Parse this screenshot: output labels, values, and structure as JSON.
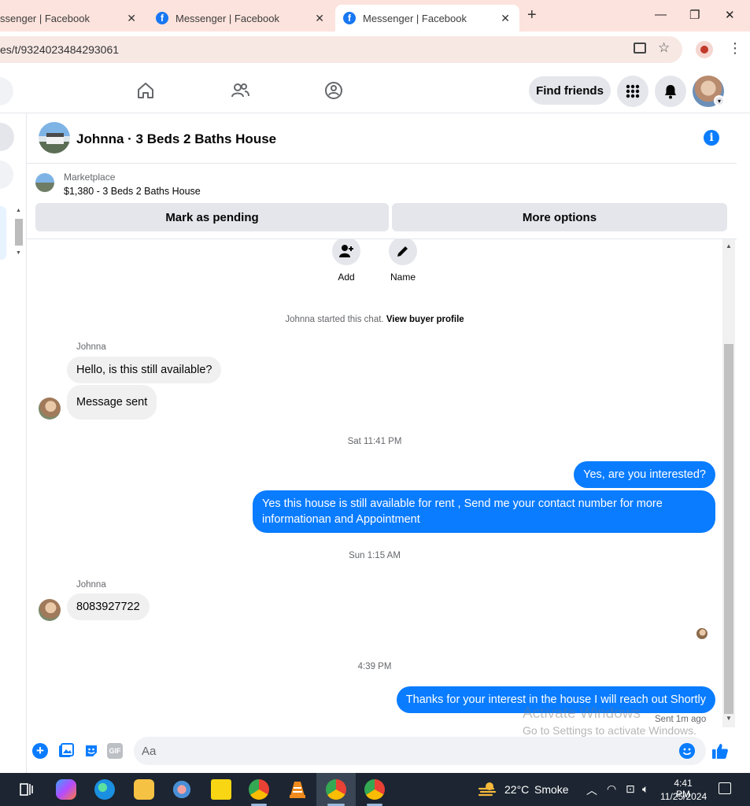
{
  "browser": {
    "tabs": [
      {
        "title": "ssenger | Facebook",
        "active": false
      },
      {
        "title": "Messenger | Facebook",
        "active": false
      },
      {
        "title": "Messenger | Facebook",
        "active": true
      }
    ],
    "url": "es/t/9324023484293061"
  },
  "nav": {
    "find_friends": "Find friends"
  },
  "conversation": {
    "title": "Johnna · 3 Beds 2 Baths House",
    "marketplace_label": "Marketplace",
    "listing": "$1,380 - 3 Beds 2 Baths House",
    "mark_pending": "Mark as pending",
    "more_options": "More options"
  },
  "chat": {
    "actions": {
      "add": "Add",
      "name": "Name"
    },
    "started_text": "Johnna started this chat.",
    "view_buyer_profile": "View buyer profile",
    "sender_name": "Johnna",
    "msg1": "Hello, is this still available?",
    "msg2": "Message sent",
    "ts1": "Sat 11:41 PM",
    "out1": "Yes, are you interested?",
    "out2": "Yes this house is still available for rent , Send me your contact number for more informationan and Appointment",
    "ts2": "Sun 1:15 AM",
    "msg3": "8083927722",
    "ts3": "4:39 PM",
    "out3": "Thanks for your interest in the house I will reach out Shortly",
    "sent_status": "Sent 1m ago"
  },
  "composer": {
    "placeholder": "Aa",
    "gif": "GIF"
  },
  "watermark": {
    "line1": "Activate Windows",
    "line2": "Go to Settings to activate Windows."
  },
  "taskbar": {
    "temp": "22°C",
    "weather": "Smoke",
    "time": "4:41 PM",
    "date": "11/25/2024"
  },
  "colors": {
    "messenger_blue": "#0a7cff",
    "facebook_blue": "#1877f2",
    "tab_strip": "#fde3dd",
    "taskbar": "#1c2531"
  }
}
